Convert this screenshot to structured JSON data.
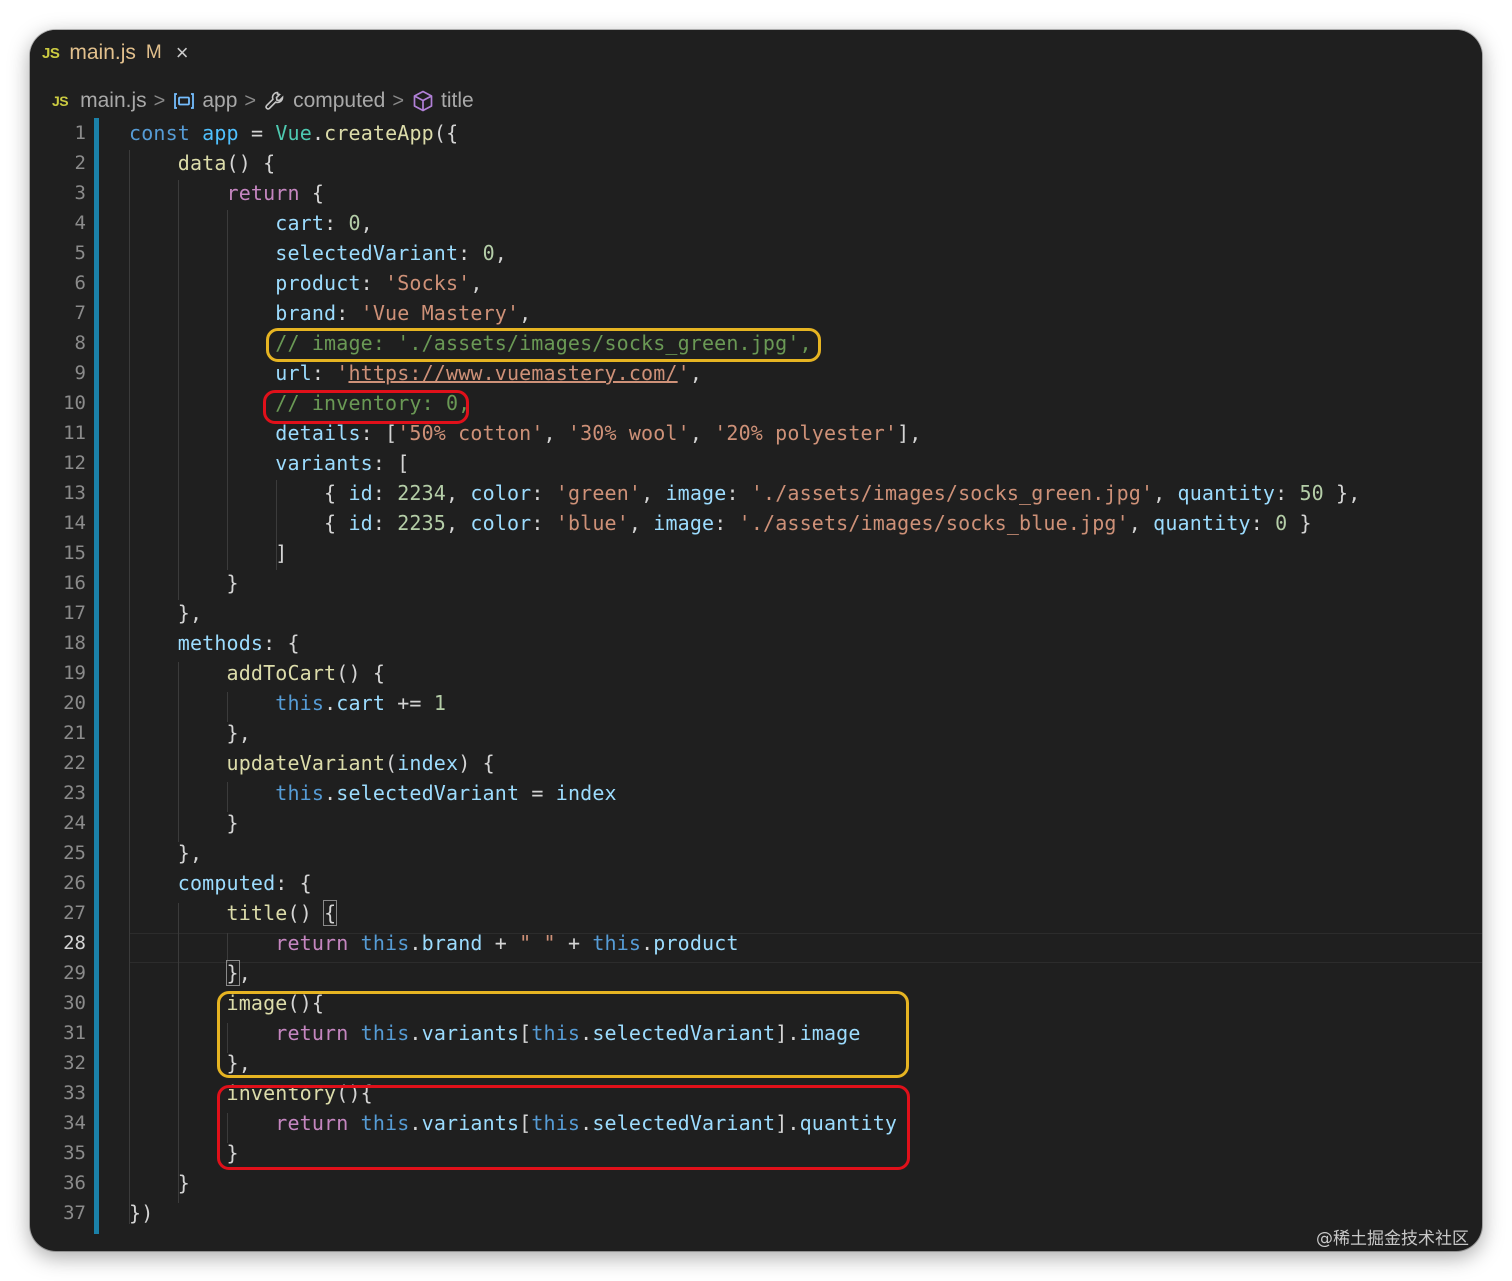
{
  "tab": {
    "file_badge": "JS",
    "filename": "main.js",
    "status": "M",
    "close": "×"
  },
  "breadcrumb": {
    "file_badge": "JS",
    "file": "main.js",
    "items": [
      "app",
      "computed",
      "title"
    ],
    "separator": ">"
  },
  "editor": {
    "active_line": 28,
    "lines": [
      "1",
      "2",
      "3",
      "4",
      "5",
      "6",
      "7",
      "8",
      "9",
      "10",
      "11",
      "12",
      "13",
      "14",
      "15",
      "16",
      "17",
      "18",
      "19",
      "20",
      "21",
      "22",
      "23",
      "24",
      "25",
      "26",
      "27",
      "28",
      "29",
      "30",
      "31",
      "32",
      "33",
      "34",
      "35",
      "36",
      "37"
    ],
    "code": {
      "l1": [
        "const",
        "app",
        "=",
        "Vue",
        "createApp"
      ],
      "l2": "data",
      "l3": "return",
      "l4": [
        "cart",
        "0"
      ],
      "l5": [
        "selectedVariant",
        "0"
      ],
      "l6": [
        "product",
        "'Socks'"
      ],
      "l7": [
        "brand",
        "'Vue Mastery'"
      ],
      "l8": "// image: './assets/images/socks_green.jpg',",
      "l9": [
        "url",
        "'",
        "https://www.vuemastery.com/",
        "'"
      ],
      "l10": "// inventory: 0,",
      "l11": [
        "details",
        "'50% cotton'",
        "'30% wool'",
        "'20% polyester'"
      ],
      "l12": "variants",
      "l13": [
        "id",
        "2234",
        "color",
        "'green'",
        "image",
        "'./assets/images/socks_green.jpg'",
        "quantity",
        "50"
      ],
      "l14": [
        "id",
        "2235",
        "color",
        "'blue'",
        "image",
        "'./assets/images/socks_blue.jpg'",
        "quantity",
        "0"
      ],
      "l18": "methods",
      "l19": "addToCart",
      "l20": [
        "this",
        "cart",
        "+=",
        "1"
      ],
      "l22": [
        "updateVariant",
        "index"
      ],
      "l23": [
        "this",
        "selectedVariant",
        "=",
        "index"
      ],
      "l26": "computed",
      "l27": "title",
      "l28": [
        "return",
        "this",
        "brand",
        "\" \"",
        "this",
        "product"
      ],
      "l30": "image",
      "l31": [
        "return",
        "this",
        "variants",
        "this",
        "selectedVariant",
        "image"
      ],
      "l33": "inventory",
      "l34": [
        "return",
        "this",
        "variants",
        "this",
        "selectedVariant",
        "quantity"
      ]
    }
  },
  "highlights": {
    "yellow": "#e6b422",
    "red": "#e0101a"
  },
  "watermark": "@稀土掘金技术社区"
}
